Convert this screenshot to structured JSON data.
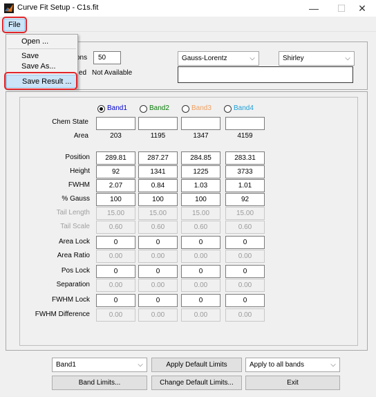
{
  "window": {
    "title": "Curve Fit Setup - C1s.fit",
    "minimize": "—",
    "maximize": "☐",
    "close": "✕"
  },
  "menu": {
    "file": "File",
    "items": [
      "Open ...",
      "Save",
      "Save As...",
      "Save Result ..."
    ]
  },
  "top": {
    "label1_partial": "ons",
    "iterations_value": "50",
    "label2_partial": "ed",
    "not_available": "Not Available",
    "lineshape": "Gauss-Lorentz",
    "background": "Shirley",
    "info_value": ""
  },
  "bands": [
    {
      "name": "Band1",
      "color": "#0000cc",
      "selected": true
    },
    {
      "name": "Band2",
      "color": "#0a7a0a",
      "selected": false
    },
    {
      "name": "Band3",
      "color": "#f0a060",
      "selected": false
    },
    {
      "name": "Band4",
      "color": "#1fa0d8",
      "selected": false
    }
  ],
  "row_labels": {
    "chem_state": "Chem State",
    "area": "Area",
    "position": "Position",
    "height": "Height",
    "fwhm": "FWHM",
    "gauss": "% Gauss",
    "tail_length": "Tail Length",
    "tail_scale": "Tail Scale",
    "area_lock": "Area Lock",
    "area_ratio": "Area Ratio",
    "pos_lock": "Pos Lock",
    "separation": "Separation",
    "fwhm_lock": "FWHM Lock",
    "fwhm_difference": "FWHM Difference"
  },
  "values": {
    "chem_state": [
      "",
      "",
      "",
      ""
    ],
    "area": [
      "203",
      "1195",
      "1347",
      "4159"
    ],
    "position": [
      "289.81",
      "287.27",
      "284.85",
      "283.31"
    ],
    "height": [
      "92",
      "1341",
      "1225",
      "3733"
    ],
    "fwhm": [
      "2.07",
      "0.84",
      "1.03",
      "1.01"
    ],
    "gauss": [
      "100",
      "100",
      "100",
      "92"
    ],
    "tail_length": [
      "15.00",
      "15.00",
      "15.00",
      "15.00"
    ],
    "tail_scale": [
      "0.60",
      "0.60",
      "0.60",
      "0.60"
    ],
    "area_lock": [
      "0",
      "0",
      "0",
      "0"
    ],
    "area_ratio": [
      "0.00",
      "0.00",
      "0.00",
      "0.00"
    ],
    "pos_lock": [
      "0",
      "0",
      "0",
      "0"
    ],
    "separation": [
      "0.00",
      "0.00",
      "0.00",
      "0.00"
    ],
    "fwhm_lock": [
      "0",
      "0",
      "0",
      "0"
    ],
    "fwhm_difference": [
      "0.00",
      "0.00",
      "0.00",
      "0.00"
    ]
  },
  "bottom": {
    "band_select": "Band1",
    "apply_default_limits": "Apply Default Limits",
    "apply_to": "Apply to all bands",
    "band_limits": "Band Limits...",
    "change_default_limits": "Change Default Limits...",
    "exit": "Exit"
  },
  "colors": {
    "highlight_red": "#e0252b",
    "menu_highlight": "#cce4f7"
  }
}
